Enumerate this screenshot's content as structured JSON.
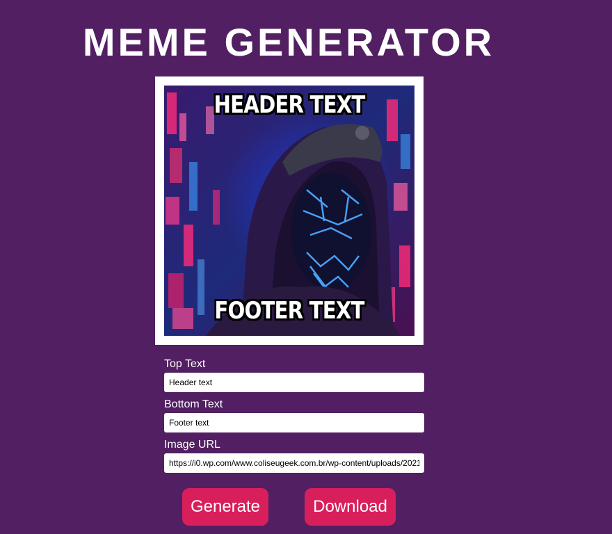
{
  "header": {
    "title": "MEME GENERATOR"
  },
  "meme": {
    "top_caption": "HEADER TEXT",
    "bottom_caption": "FOOTER TEXT"
  },
  "form": {
    "top_text_label": "Top Text",
    "top_text_value": "Header text",
    "bottom_text_label": "Bottom Text",
    "bottom_text_value": "Footer text",
    "image_url_label": "Image URL",
    "image_url_value": "https://i0.wp.com/www.coliseugeek.com.br/wp-content/uploads/2021"
  },
  "actions": {
    "generate_label": "Generate",
    "download_label": "Download"
  },
  "colors": {
    "background": "#521f62",
    "button": "#d81f5c",
    "frame": "#ffffff",
    "text": "#ffffff"
  }
}
